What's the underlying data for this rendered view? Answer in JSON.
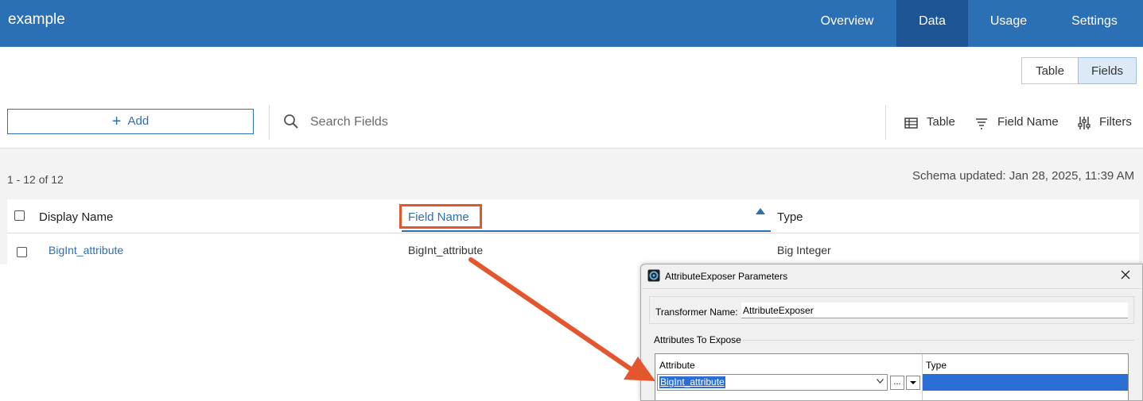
{
  "header": {
    "title": "example",
    "tabs": [
      {
        "label": "Overview"
      },
      {
        "label": "Data"
      },
      {
        "label": "Usage"
      },
      {
        "label": "Settings"
      }
    ],
    "active_tab": "Data"
  },
  "view_toggle": {
    "table_label": "Table",
    "fields_label": "Fields",
    "selected": "Fields"
  },
  "toolbar": {
    "add_label": "Add",
    "add_icon": "plus-icon",
    "search_placeholder": "Search Fields",
    "table_label": "Table",
    "field_name_label": "Field Name",
    "filters_label": "Filters"
  },
  "summary": {
    "count": "1 - 12 of 12",
    "schema_updated": "Schema updated: Jan 28, 2025, 11:39 AM"
  },
  "table": {
    "headers": {
      "display_name": "Display Name",
      "field_name": "Field Name",
      "type": "Type"
    },
    "sort": "ascending",
    "rows": [
      {
        "display_name": "BigInt_attribute",
        "field_name": "BigInt_attribute",
        "type": "Big Integer"
      }
    ]
  },
  "dialog": {
    "title": "AttributeExposer Parameters",
    "transformer_label": "Transformer Name:",
    "transformer_value": "AttributeExposer",
    "expose_label": "Attributes To Expose",
    "grid_headers": {
      "attribute": "Attribute",
      "type": "Type"
    },
    "selected_attribute": "BigInt_attribute",
    "ellipsis": "...",
    "type_value": ""
  },
  "colors": {
    "header_bg": "#2b6fb5",
    "active_tab_bg": "#1d5494",
    "annotation": "#e4572e",
    "selection": "#2b6fd6"
  }
}
